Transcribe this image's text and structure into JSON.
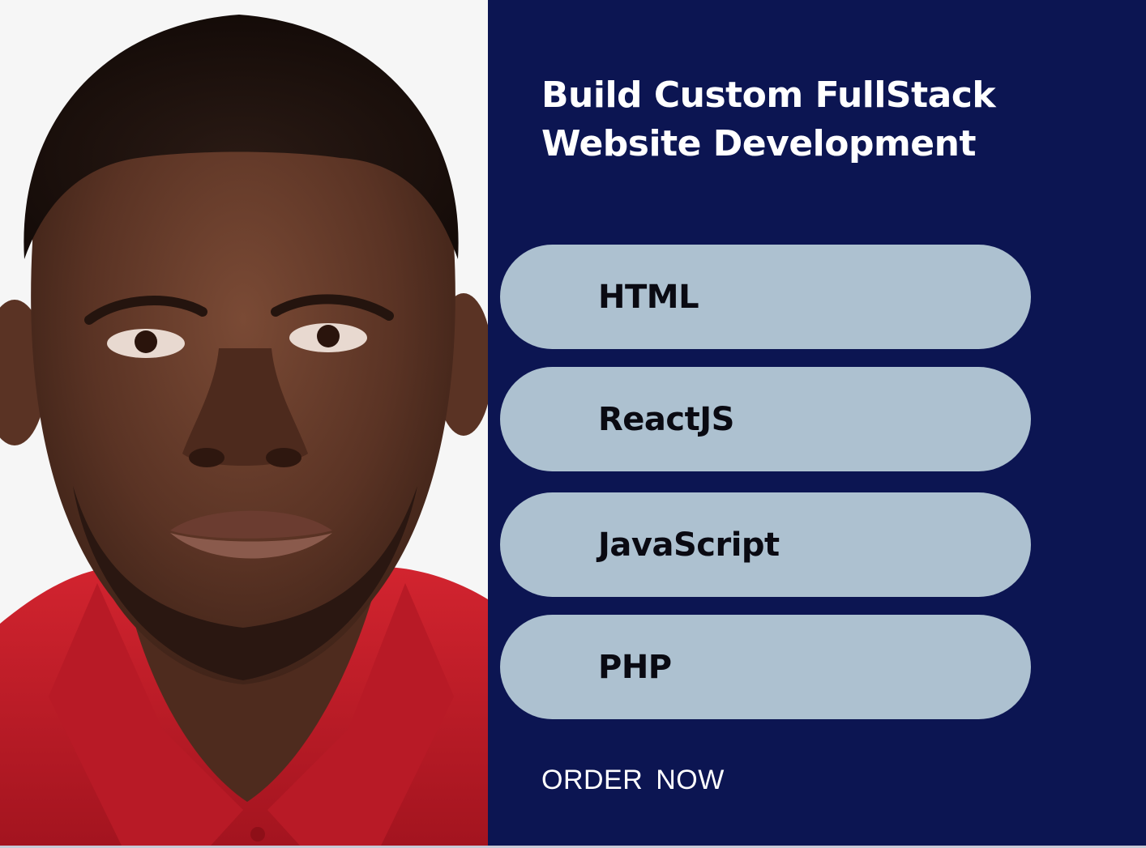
{
  "headline": {
    "line1": "Build Custom FullStack",
    "line2": "Website Development"
  },
  "skills": [
    {
      "label": "HTML"
    },
    {
      "label": "ReactJS"
    },
    {
      "label": "JavaScript"
    },
    {
      "label": "PHP"
    }
  ],
  "cta": {
    "label": "ORDER  NOW"
  },
  "colors": {
    "panel": "#0c1552",
    "pill": "#adc1d0",
    "shirt": "#c8202e",
    "text_light": "#ffffff",
    "text_dark": "#0a0a12"
  }
}
